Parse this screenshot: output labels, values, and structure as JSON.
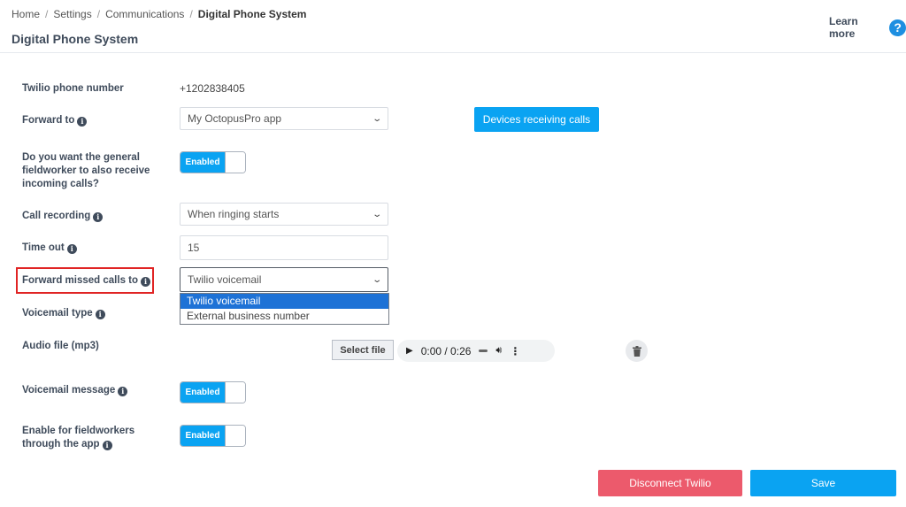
{
  "breadcrumb": {
    "items": [
      "Home",
      "Settings",
      "Communications"
    ],
    "current": "Digital Phone System",
    "separator": "/"
  },
  "page_title": "Digital Phone System",
  "learn_more": {
    "label": "Learn more",
    "icon": "help-icon",
    "glyph": "?"
  },
  "info_glyph": "i",
  "form": {
    "phone_number": {
      "label": "Twilio phone number",
      "value": "+1202838405"
    },
    "forward_to": {
      "label": "Forward to",
      "value": "My OctopusPro app",
      "button": "Devices receiving calls"
    },
    "general_fieldworker": {
      "label": "Do you want the general fieldworker to also receive incoming calls?",
      "toggle": "Enabled"
    },
    "call_recording": {
      "label": "Call recording",
      "value": "When ringing starts"
    },
    "time_out": {
      "label": "Time out",
      "value": "15"
    },
    "forward_missed": {
      "label": "Forward missed calls to",
      "value": "Twilio voicemail",
      "options": [
        "Twilio voicemail",
        "External business number"
      ],
      "selected_index": 0
    },
    "voicemail_type": {
      "label": "Voicemail type"
    },
    "audio_file": {
      "label": "Audio file (mp3)",
      "select_button": "Select file",
      "time": "0:00 / 0:26"
    },
    "voicemail_message": {
      "label": "Voicemail message",
      "toggle": "Enabled"
    },
    "fieldworkers_app": {
      "label": "Enable for fieldworkers through the app",
      "toggle": "Enabled"
    }
  },
  "actions": {
    "disconnect": "Disconnect Twilio",
    "save": "Save"
  },
  "colors": {
    "accent": "#0aa3f2",
    "danger": "#ec5a6c",
    "highlight": "#e02424",
    "selected_option": "#1e72d6"
  }
}
